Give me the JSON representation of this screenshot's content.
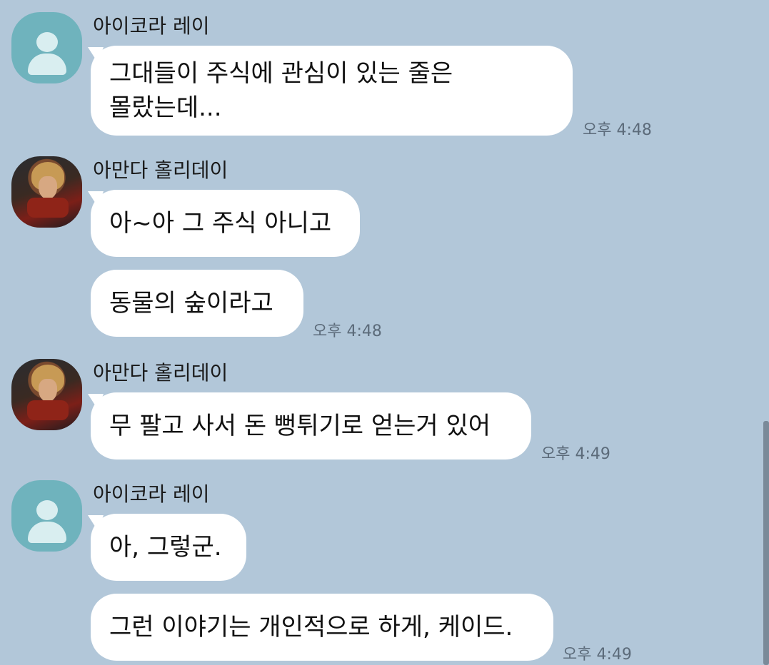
{
  "messages": [
    {
      "sender": "아이코라 레이",
      "avatar": "default-user-avatar",
      "lines": [
        "그대들이 주식에 관심이 있는 줄은",
        "몰랐는데..."
      ],
      "time": "오후 4:48"
    },
    {
      "sender": "아만다 홀리데이",
      "avatar": "photo-avatar",
      "bubbles": [
        "아~아 그 주식 아니고",
        "동물의 숲이라고"
      ],
      "time": "오후 4:48"
    },
    {
      "sender": "아만다 홀리데이",
      "avatar": "photo-avatar",
      "bubbles": [
        "무 팔고 사서 돈 뻥튀기로 얻는거 있어"
      ],
      "time": "오후 4:49"
    },
    {
      "sender": "아이코라 레이",
      "avatar": "default-user-avatar",
      "bubbles": [
        "아, 그렇군.",
        "그런 이야기는 개인적으로 하게, 케이드."
      ],
      "time": "오후 4:49"
    }
  ],
  "colors": {
    "background": "#b2c7d9",
    "bubble": "#ffffff",
    "default_avatar": "#6fb3bd",
    "timestamp": "#5c6b7a"
  }
}
